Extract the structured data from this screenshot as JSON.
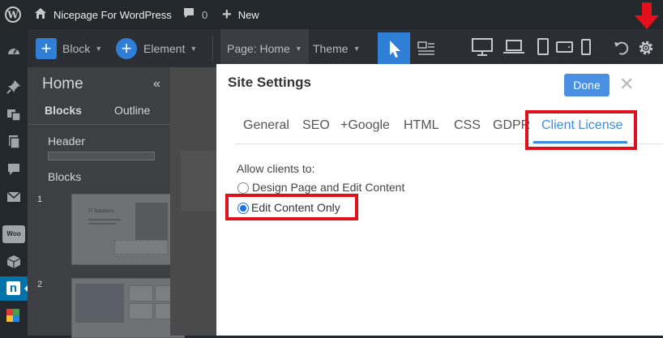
{
  "admin_bar": {
    "site_name": "Nicepage For WordPress",
    "comments_count": "0",
    "new_label": "New"
  },
  "toolbar": {
    "block_label": "Block",
    "element_label": "Element",
    "page_label": "Page: Home",
    "theme_label": "Theme"
  },
  "panel": {
    "title": "Home",
    "collapse_glyph": "«",
    "tabs": [
      "Blocks",
      "Outline"
    ],
    "header_label": "Header",
    "blocks_label": "Blocks",
    "items": [
      {
        "number": "1",
        "thumb_text": "IT Solutions"
      },
      {
        "number": "2",
        "thumb_text": ""
      }
    ]
  },
  "dialog": {
    "title": "Site Settings",
    "done_label": "Done",
    "close_glyph": "✕",
    "tabs": [
      "General",
      "SEO",
      "+Google",
      "HTML",
      "CSS",
      "GDPR",
      "Client License"
    ],
    "active_tab": "Client License",
    "allow_label": "Allow clients to:",
    "options": [
      {
        "label": "Design Page and Edit Content",
        "selected": false
      },
      {
        "label": "Edit Content Only",
        "selected": true
      }
    ]
  },
  "colors": {
    "accent": "#2f7fd6",
    "highlight": "#e0101b"
  }
}
